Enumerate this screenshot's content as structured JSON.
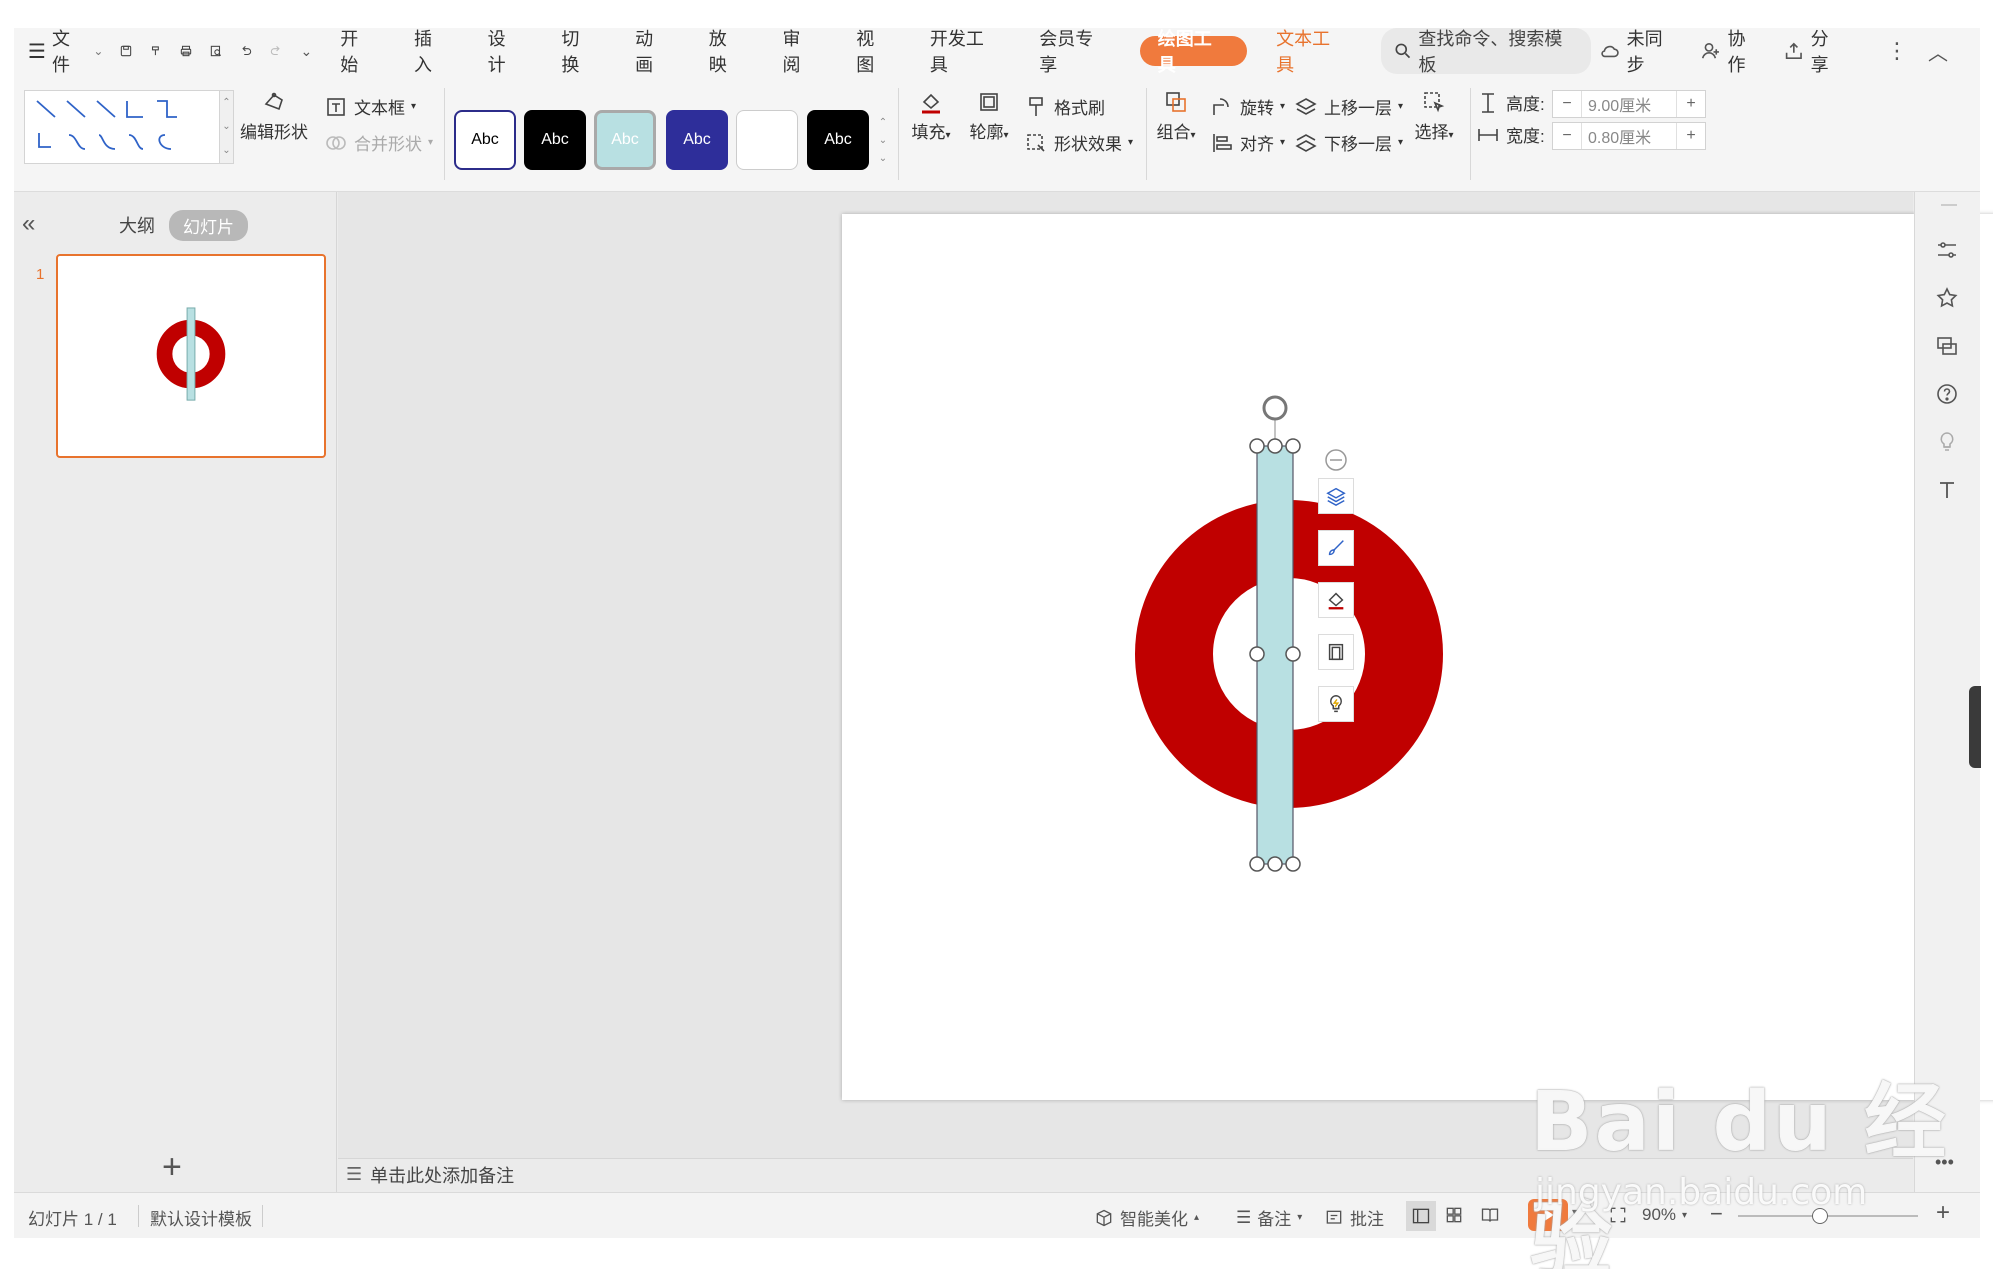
{
  "menubar": {
    "file": "文件",
    "tabs": [
      "开始",
      "插入",
      "设计",
      "切换",
      "动画",
      "放映",
      "审阅",
      "视图",
      "开发工具",
      "会员专享"
    ],
    "tab_draw": "绘图工具",
    "tab_text": "文本工具",
    "search_placeholder": "查找命令、搜索模板",
    "sync": "未同步",
    "collab": "协作",
    "share": "分享"
  },
  "ribbon": {
    "edit_shape": "编辑形状",
    "text_box": "文本框",
    "merge_shape": "合并形状",
    "style_label": "Abc",
    "fill": "填充",
    "outline": "轮廓",
    "format_painter": "格式刷",
    "shape_effect": "形状效果",
    "group": "组合",
    "rotate": "旋转",
    "align": "对齐",
    "bring_forward": "上移一层",
    "send_backward": "下移一层",
    "select": "选择",
    "height_label": "高度:",
    "height_value": "9.00厘米",
    "width_label": "宽度:",
    "width_value": "0.80厘米",
    "minus": "−",
    "plus": "+"
  },
  "left_panel": {
    "tab_outline": "大纲",
    "tab_slides": "幻灯片",
    "slide_number": "1"
  },
  "notes": {
    "placeholder": "单击此处添加备注"
  },
  "statusbar": {
    "slide_info": "幻灯片 1 / 1",
    "template": "默认设计模板",
    "beautify": "智能美化",
    "notes": "备注",
    "comments": "批注",
    "zoom": "90%"
  },
  "watermark": {
    "brand": "Bai du 经验",
    "url": "jingyan.baidu.com"
  },
  "colors": {
    "accent": "#e8732d",
    "ring": "#c00000",
    "bar": "#b8e0e2"
  }
}
